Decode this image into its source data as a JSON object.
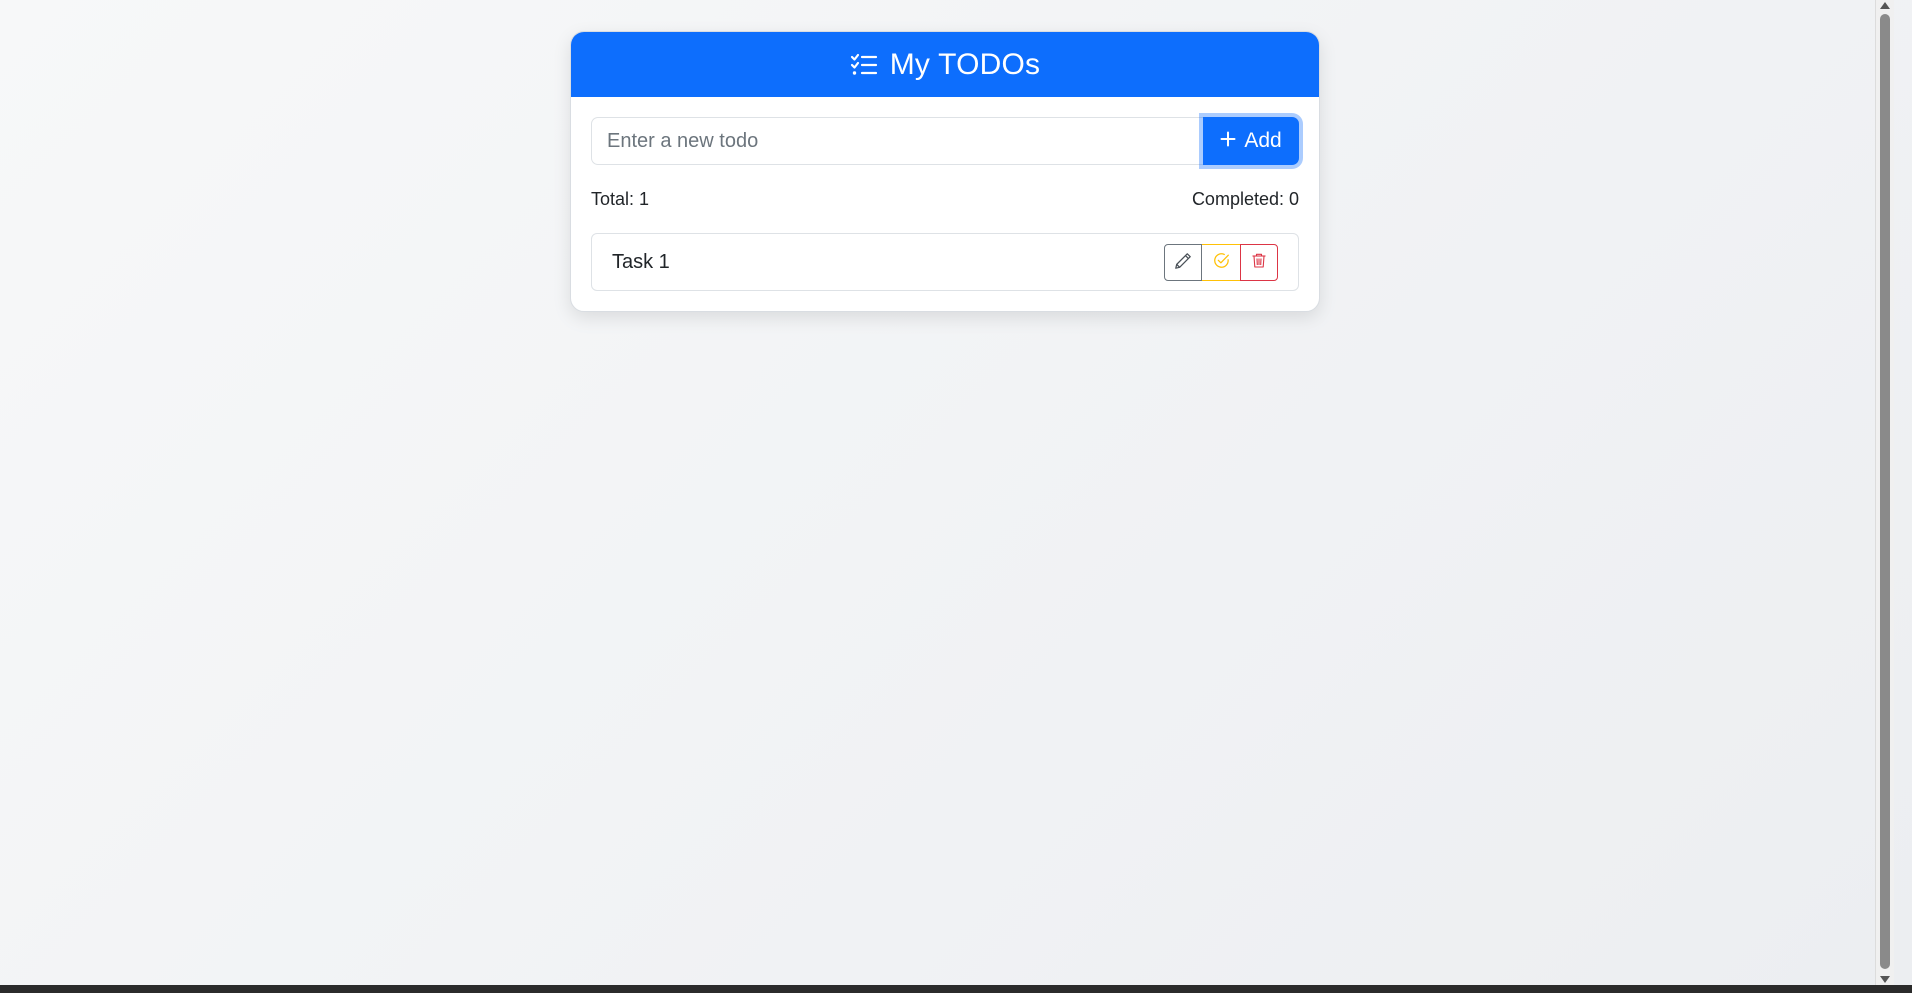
{
  "header": {
    "title": "My TODOs",
    "icon": "list-check-icon"
  },
  "form": {
    "input_placeholder": "Enter a new todo",
    "input_value": "",
    "add_label": "Add"
  },
  "stats": {
    "total_label": "Total: 1",
    "completed_label": "Completed: 0"
  },
  "todos": [
    {
      "text": "Task 1",
      "actions": [
        "pencil-icon",
        "check-circle-icon",
        "trash-icon"
      ]
    }
  ],
  "colors": {
    "primary": "#0d6efd",
    "edit": "#6c757d",
    "complete": "#ffc107",
    "delete": "#dc3545"
  }
}
